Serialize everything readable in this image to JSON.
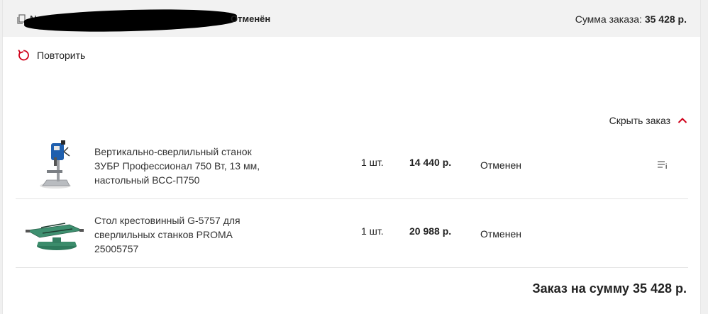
{
  "header": {
    "order_prefix": "№",
    "status": "Отменён",
    "sum_label": "Сумма заказа:",
    "sum_value": "35 428 р."
  },
  "actions": {
    "repeat_label": "Повторить",
    "toggle_label": "Скрыть заказ"
  },
  "items": [
    {
      "name": "Вертикально-сверлильный станок ЗУБР Профессионал 750 Вт, 13 мм, настольный ВСС-П750",
      "qty": "1 шт.",
      "price": "14 440 р.",
      "status": "Отменен"
    },
    {
      "name": "Стол крестовинный G-5757 для сверлильных станков PROMA 25005757",
      "qty": "1 шт.",
      "price": "20 988 р.",
      "status": "Отменен"
    }
  ],
  "footer": {
    "total": "Заказ на сумму 35 428 р."
  },
  "colors": {
    "accent": "#d0021b",
    "header_bg": "#f2f2f2"
  }
}
